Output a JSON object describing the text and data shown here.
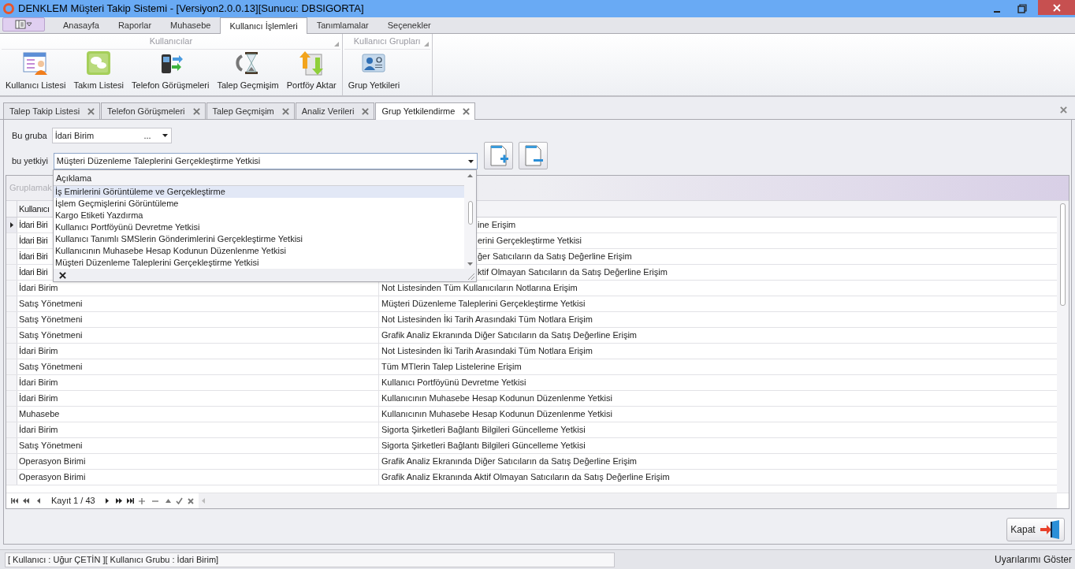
{
  "window": {
    "title": "DENKLEM Müşteri Takip Sistemi - [Versiyon2.0.0.13][Sunucu: DBSIGORTA]"
  },
  "ribbon_tabs": [
    {
      "label": "Anasayfa",
      "selected": false
    },
    {
      "label": "Raporlar",
      "selected": false
    },
    {
      "label": "Muhasebe",
      "selected": false
    },
    {
      "label": "Kullanıcı İşlemleri",
      "selected": true
    },
    {
      "label": "Tanımlamalar",
      "selected": false
    },
    {
      "label": "Seçenekler",
      "selected": false
    }
  ],
  "ribbon_groups": [
    {
      "title": "Kullanıcılar",
      "buttons": [
        {
          "label": "Kullanıcı Listesi",
          "kind": "user-list"
        },
        {
          "label": "Takım Listesi",
          "kind": "chat"
        },
        {
          "label": "Telefon Görüşmeleri",
          "kind": "phone"
        },
        {
          "label": "Talep Geçmişim",
          "kind": "hourglass"
        },
        {
          "label": "Portföy Aktar",
          "kind": "transfer"
        }
      ]
    },
    {
      "title": "Kullanıcı Grupları",
      "buttons": [
        {
          "label": "Grup Yetkileri",
          "kind": "contact-card"
        }
      ]
    }
  ],
  "document_tabs": [
    {
      "label": "Talep Takip Listesi",
      "selected": false
    },
    {
      "label": "Telefon Görüşmeleri",
      "selected": false
    },
    {
      "label": "Talep Geçmişim",
      "selected": false
    },
    {
      "label": "Analiz Verileri",
      "selected": false
    },
    {
      "label": "Grup Yetkilendirme",
      "selected": true
    }
  ],
  "form": {
    "group_label": "Bu gruba",
    "group_value": "İdari Birim",
    "group_ellipsis": "...",
    "permission_label": "bu yetkiyi",
    "permission_value": "Müşteri Düzenleme Taleplerini Gerçekleştirme Yetkisi"
  },
  "dropdown": {
    "header": "Açıklama",
    "items": [
      {
        "label": "İş Emirlerini Görüntüleme ve Gerçekleştirme",
        "selected": true
      },
      {
        "label": "İşlem Geçmişlerini Görüntüleme",
        "selected": false
      },
      {
        "label": "Kargo Etiketi Yazdırma",
        "selected": false
      },
      {
        "label": "Kullanıcı Portföyünü Devretme Yetkisi",
        "selected": false
      },
      {
        "label": "Kullanıcı Tanımlı SMSlerin Gönderimlerini Gerçekleştirme Yetkisi",
        "selected": false
      },
      {
        "label": "Kullanıcının Muhasebe Hesap Kodunun Düzenlenme Yetkisi",
        "selected": false
      },
      {
        "label": "Müşteri Düzenleme Taleplerini Gerçekleştirme Yetkisi",
        "selected": false
      }
    ]
  },
  "grid": {
    "group_panel": "Gruplamak",
    "columns": [
      "Kullanıcı"
    ],
    "rows": [
      {
        "cells": [
          "İdari Biri",
          "ine Erişim"
        ],
        "selected": true
      },
      {
        "cells": [
          "İdari Biri",
          "erini Gerçekleştirme Yetkisi"
        ],
        "selected": false
      },
      {
        "cells": [
          "İdari Biri",
          "ğer Satıcıların da Satış Değerline Erişim"
        ],
        "selected": false
      },
      {
        "cells": [
          "İdari Biri",
          "ktif Olmayan Satıcıların da Satış Değerline Erişim"
        ],
        "selected": false
      },
      {
        "cells": [
          "İdari Birim",
          "Not Listesinden Tüm Kullanıcıların Notlarına Erişim"
        ],
        "selected": false
      },
      {
        "cells": [
          "Satış Yönetmeni",
          "Müşteri Düzenleme Taleplerini Gerçekleştirme Yetkisi"
        ],
        "selected": false
      },
      {
        "cells": [
          "Satış Yönetmeni",
          "Not Listesinden İki Tarih Arasındaki Tüm Notlara Erişim"
        ],
        "selected": false
      },
      {
        "cells": [
          "Satış Yönetmeni",
          "Grafik Analiz Ekranında Diğer Satıcıların da Satış Değerline Erişim"
        ],
        "selected": false
      },
      {
        "cells": [
          "İdari Birim",
          "Not Listesinden İki Tarih Arasındaki Tüm Notlara Erişim"
        ],
        "selected": false
      },
      {
        "cells": [
          "Satış Yönetmeni",
          "Tüm MTlerin Talep Listelerine Erişim"
        ],
        "selected": false
      },
      {
        "cells": [
          "İdari Birim",
          "Kullanıcı Portföyünü Devretme Yetkisi"
        ],
        "selected": false
      },
      {
        "cells": [
          "İdari Birim",
          "Kullanıcının Muhasebe Hesap Kodunun Düzenlenme Yetkisi"
        ],
        "selected": false
      },
      {
        "cells": [
          "Muhasebe",
          "Kullanıcının Muhasebe Hesap Kodunun Düzenlenme Yetkisi"
        ],
        "selected": false
      },
      {
        "cells": [
          "İdari Birim",
          "Sigorta Şirketleri Bağlantı Bilgileri Güncelleme Yetkisi"
        ],
        "selected": false
      },
      {
        "cells": [
          "Satış Yönetmeni",
          "Sigorta Şirketleri Bağlantı Bilgileri Güncelleme Yetkisi"
        ],
        "selected": false
      },
      {
        "cells": [
          "Operasyon Birimi",
          "Grafik Analiz Ekranında Diğer Satıcıların da Satış Değerline Erişim"
        ],
        "selected": false
      },
      {
        "cells": [
          "Operasyon Birimi",
          "Grafik Analiz Ekranında Aktif Olmayan Satıcıların da Satış Değerline Erişim"
        ],
        "selected": false
      }
    ],
    "navigator": {
      "record": "Kayıt 1 / 43"
    }
  },
  "close_button": "Kapat",
  "status_bar": {
    "user": "[ Kullanıcı : Uğur ÇETİN ][ Kullanıcı Grubu : İdari Birim]",
    "alerts": "Uyarılarımı Göster"
  }
}
